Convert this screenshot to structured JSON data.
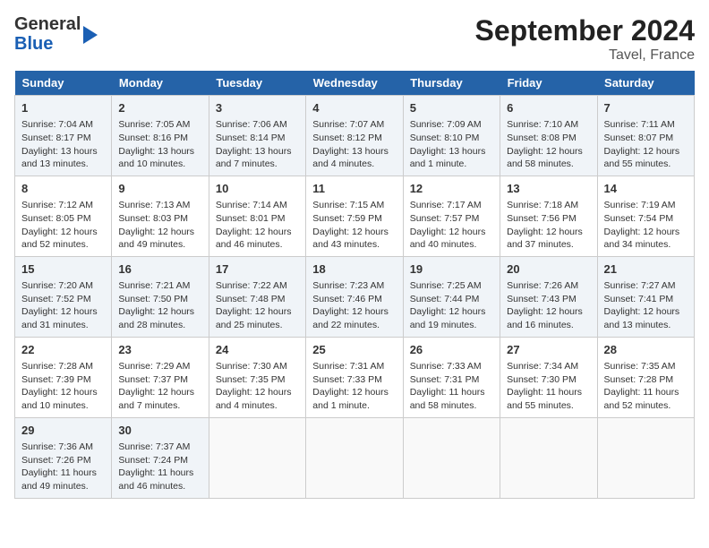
{
  "logo": {
    "line1": "General",
    "line2": "Blue"
  },
  "title": "September 2024",
  "location": "Tavel, France",
  "days_header": [
    "Sunday",
    "Monday",
    "Tuesday",
    "Wednesday",
    "Thursday",
    "Friday",
    "Saturday"
  ],
  "weeks": [
    [
      {
        "day": "1",
        "info": "Sunrise: 7:04 AM\nSunset: 8:17 PM\nDaylight: 13 hours\nand 13 minutes."
      },
      {
        "day": "2",
        "info": "Sunrise: 7:05 AM\nSunset: 8:16 PM\nDaylight: 13 hours\nand 10 minutes."
      },
      {
        "day": "3",
        "info": "Sunrise: 7:06 AM\nSunset: 8:14 PM\nDaylight: 13 hours\nand 7 minutes."
      },
      {
        "day": "4",
        "info": "Sunrise: 7:07 AM\nSunset: 8:12 PM\nDaylight: 13 hours\nand 4 minutes."
      },
      {
        "day": "5",
        "info": "Sunrise: 7:09 AM\nSunset: 8:10 PM\nDaylight: 13 hours\nand 1 minute."
      },
      {
        "day": "6",
        "info": "Sunrise: 7:10 AM\nSunset: 8:08 PM\nDaylight: 12 hours\nand 58 minutes."
      },
      {
        "day": "7",
        "info": "Sunrise: 7:11 AM\nSunset: 8:07 PM\nDaylight: 12 hours\nand 55 minutes."
      }
    ],
    [
      {
        "day": "8",
        "info": "Sunrise: 7:12 AM\nSunset: 8:05 PM\nDaylight: 12 hours\nand 52 minutes."
      },
      {
        "day": "9",
        "info": "Sunrise: 7:13 AM\nSunset: 8:03 PM\nDaylight: 12 hours\nand 49 minutes."
      },
      {
        "day": "10",
        "info": "Sunrise: 7:14 AM\nSunset: 8:01 PM\nDaylight: 12 hours\nand 46 minutes."
      },
      {
        "day": "11",
        "info": "Sunrise: 7:15 AM\nSunset: 7:59 PM\nDaylight: 12 hours\nand 43 minutes."
      },
      {
        "day": "12",
        "info": "Sunrise: 7:17 AM\nSunset: 7:57 PM\nDaylight: 12 hours\nand 40 minutes."
      },
      {
        "day": "13",
        "info": "Sunrise: 7:18 AM\nSunset: 7:56 PM\nDaylight: 12 hours\nand 37 minutes."
      },
      {
        "day": "14",
        "info": "Sunrise: 7:19 AM\nSunset: 7:54 PM\nDaylight: 12 hours\nand 34 minutes."
      }
    ],
    [
      {
        "day": "15",
        "info": "Sunrise: 7:20 AM\nSunset: 7:52 PM\nDaylight: 12 hours\nand 31 minutes."
      },
      {
        "day": "16",
        "info": "Sunrise: 7:21 AM\nSunset: 7:50 PM\nDaylight: 12 hours\nand 28 minutes."
      },
      {
        "day": "17",
        "info": "Sunrise: 7:22 AM\nSunset: 7:48 PM\nDaylight: 12 hours\nand 25 minutes."
      },
      {
        "day": "18",
        "info": "Sunrise: 7:23 AM\nSunset: 7:46 PM\nDaylight: 12 hours\nand 22 minutes."
      },
      {
        "day": "19",
        "info": "Sunrise: 7:25 AM\nSunset: 7:44 PM\nDaylight: 12 hours\nand 19 minutes."
      },
      {
        "day": "20",
        "info": "Sunrise: 7:26 AM\nSunset: 7:43 PM\nDaylight: 12 hours\nand 16 minutes."
      },
      {
        "day": "21",
        "info": "Sunrise: 7:27 AM\nSunset: 7:41 PM\nDaylight: 12 hours\nand 13 minutes."
      }
    ],
    [
      {
        "day": "22",
        "info": "Sunrise: 7:28 AM\nSunset: 7:39 PM\nDaylight: 12 hours\nand 10 minutes."
      },
      {
        "day": "23",
        "info": "Sunrise: 7:29 AM\nSunset: 7:37 PM\nDaylight: 12 hours\nand 7 minutes."
      },
      {
        "day": "24",
        "info": "Sunrise: 7:30 AM\nSunset: 7:35 PM\nDaylight: 12 hours\nand 4 minutes."
      },
      {
        "day": "25",
        "info": "Sunrise: 7:31 AM\nSunset: 7:33 PM\nDaylight: 12 hours\nand 1 minute."
      },
      {
        "day": "26",
        "info": "Sunrise: 7:33 AM\nSunset: 7:31 PM\nDaylight: 11 hours\nand 58 minutes."
      },
      {
        "day": "27",
        "info": "Sunrise: 7:34 AM\nSunset: 7:30 PM\nDaylight: 11 hours\nand 55 minutes."
      },
      {
        "day": "28",
        "info": "Sunrise: 7:35 AM\nSunset: 7:28 PM\nDaylight: 11 hours\nand 52 minutes."
      }
    ],
    [
      {
        "day": "29",
        "info": "Sunrise: 7:36 AM\nSunset: 7:26 PM\nDaylight: 11 hours\nand 49 minutes."
      },
      {
        "day": "30",
        "info": "Sunrise: 7:37 AM\nSunset: 7:24 PM\nDaylight: 11 hours\nand 46 minutes."
      },
      {
        "day": "",
        "info": ""
      },
      {
        "day": "",
        "info": ""
      },
      {
        "day": "",
        "info": ""
      },
      {
        "day": "",
        "info": ""
      },
      {
        "day": "",
        "info": ""
      }
    ]
  ]
}
